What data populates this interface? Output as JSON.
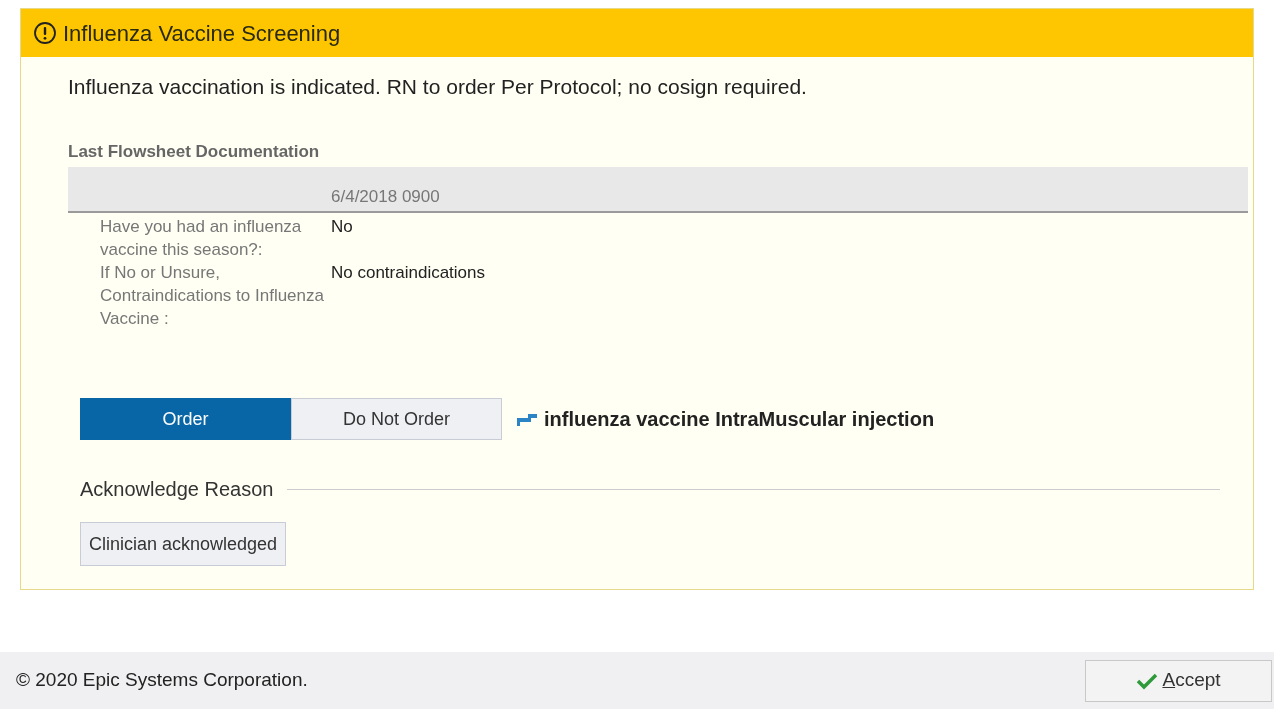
{
  "alert": {
    "title": "Influenza Vaccine Screening",
    "message": "Influenza vaccination is indicated. RN to order Per Protocol; no cosign required.",
    "flowsheet": {
      "heading": "Last Flowsheet Documentation",
      "column": "6/4/2018 0900",
      "rows": [
        {
          "question": "Have you had an influenza vaccine this season?:",
          "answer": "No"
        },
        {
          "question": "If No or Unsure, Contraindications to Influenza Vaccine :",
          "answer": "No contraindications"
        }
      ]
    },
    "choices": [
      {
        "label": "Order",
        "selected": true
      },
      {
        "label": "Do Not Order",
        "selected": false
      }
    ],
    "order_name": "influenza vaccine IntraMuscular injection",
    "acknowledge": {
      "heading": "Acknowledge Reason",
      "options": [
        {
          "label": "Clinician acknowledged",
          "selected": false
        }
      ]
    }
  },
  "footer": {
    "copyright": "© 2020 Epic Systems Corporation.",
    "accept": "Accept"
  }
}
